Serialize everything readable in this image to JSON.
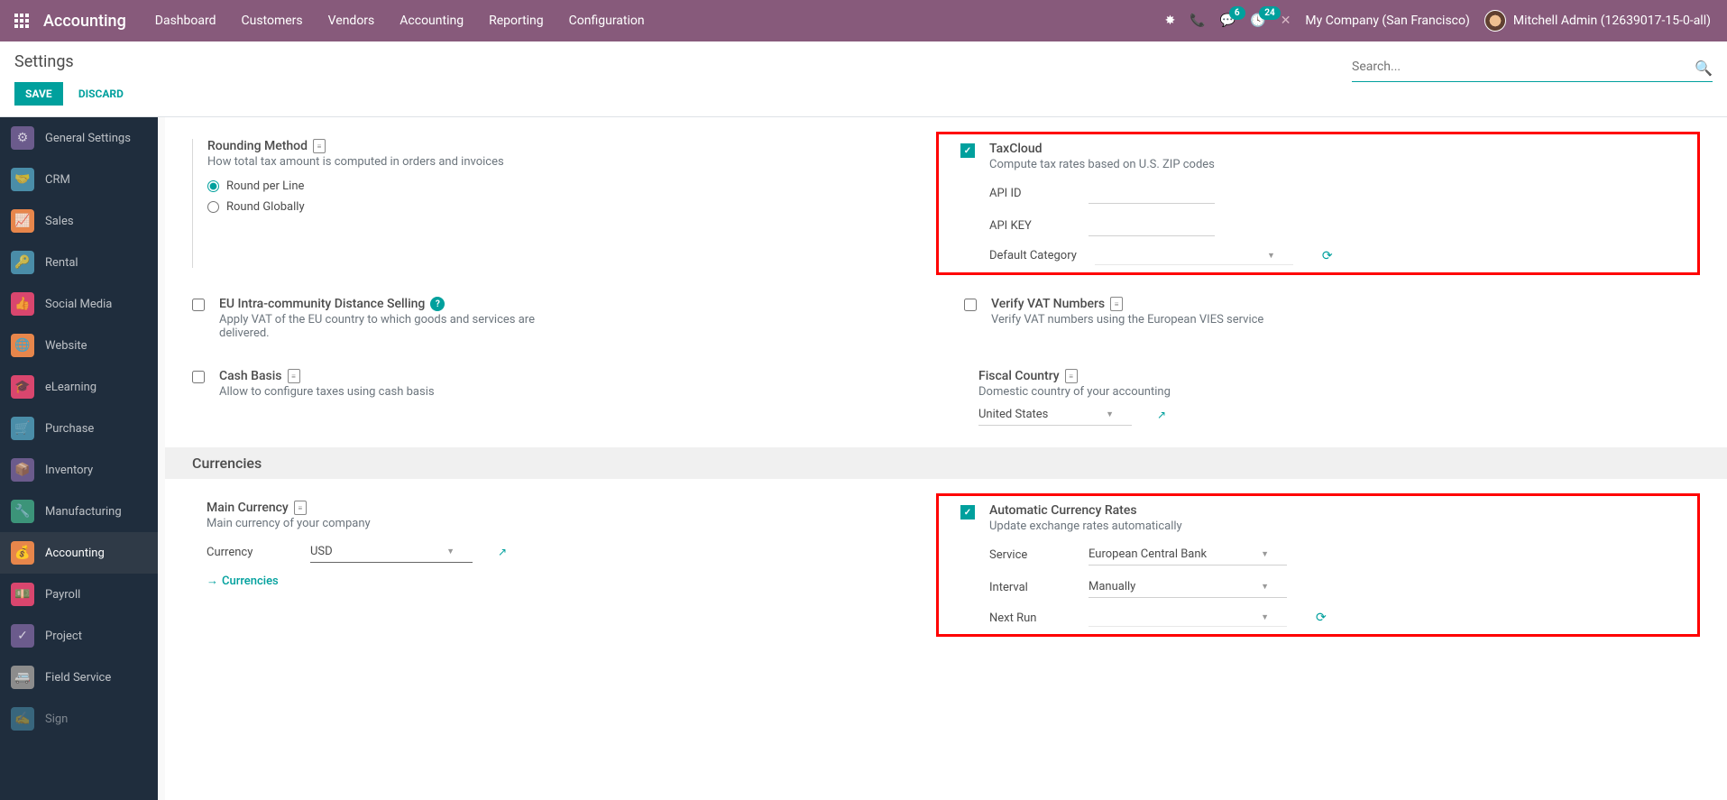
{
  "nav": {
    "brand": "Accounting",
    "menu": [
      "Dashboard",
      "Customers",
      "Vendors",
      "Accounting",
      "Reporting",
      "Configuration"
    ],
    "messages_badge": "6",
    "activities_badge": "24",
    "company": "My Company (San Francisco)",
    "user": "Mitchell Admin (12639017-15-0-all)"
  },
  "control": {
    "title": "Settings",
    "save": "SAVE",
    "discard": "DISCARD",
    "search_placeholder": "Search..."
  },
  "sidebar": {
    "items": [
      "General Settings",
      "CRM",
      "Sales",
      "Rental",
      "Social Media",
      "Website",
      "eLearning",
      "Purchase",
      "Inventory",
      "Manufacturing",
      "Accounting",
      "Payroll",
      "Project",
      "Field Service",
      "Sign"
    ]
  },
  "settings": {
    "rounding": {
      "title": "Rounding Method",
      "desc": "How total tax amount is computed in orders and invoices",
      "opt1": "Round per Line",
      "opt2": "Round Globally"
    },
    "taxcloud": {
      "title": "TaxCloud",
      "desc": "Compute tax rates based on U.S. ZIP codes",
      "api_id_label": "API ID",
      "api_key_label": "API KEY",
      "default_cat_label": "Default Category"
    },
    "eu": {
      "title": "EU Intra-community Distance Selling",
      "desc": "Apply VAT of the EU country to which goods and services are delivered."
    },
    "vat": {
      "title": "Verify VAT Numbers",
      "desc": "Verify VAT numbers using the European VIES service"
    },
    "cash": {
      "title": "Cash Basis",
      "desc": "Allow to configure taxes using cash basis"
    },
    "fiscal": {
      "title": "Fiscal Country",
      "desc": "Domestic country of your accounting",
      "value": "United States"
    },
    "section_currencies": "Currencies",
    "main_currency": {
      "title": "Main Currency",
      "desc": "Main currency of your company",
      "currency_label": "Currency",
      "currency_value": "USD",
      "link": "Currencies"
    },
    "auto_rates": {
      "title": "Automatic Currency Rates",
      "desc": "Update exchange rates automatically",
      "service_label": "Service",
      "service_value": "European Central Bank",
      "interval_label": "Interval",
      "interval_value": "Manually",
      "next_run_label": "Next Run"
    }
  }
}
